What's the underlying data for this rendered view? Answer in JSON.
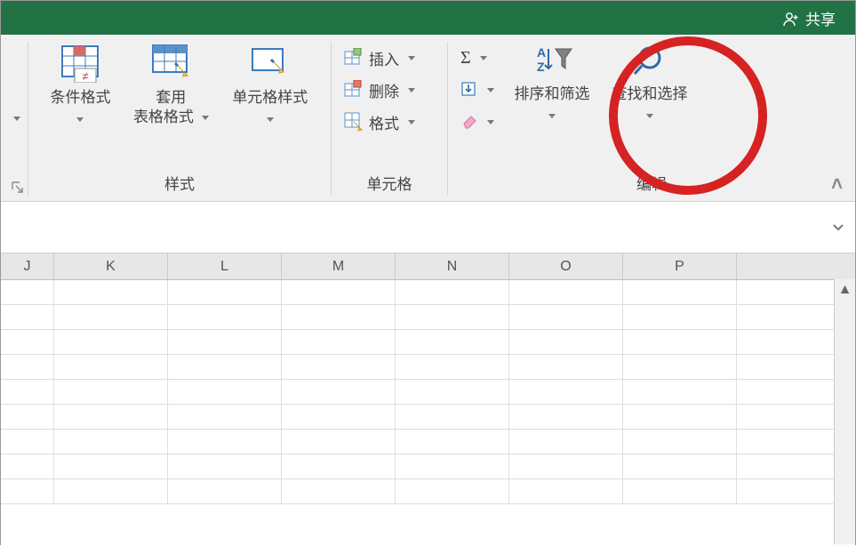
{
  "titlebar": {
    "share": "共享"
  },
  "styles_group": {
    "label": "样式",
    "cond_format": "条件格式",
    "table_format": "套用\n表格格式",
    "cell_styles": "单元格样式"
  },
  "cells_group": {
    "label": "单元格",
    "insert": "插入",
    "delete": "删除",
    "format": "格式"
  },
  "edit_group": {
    "label": "编辑",
    "sort_filter": "排序和筛选",
    "find_select": "查找和选择"
  },
  "columns": [
    "J",
    "K",
    "L",
    "M",
    "N",
    "O",
    "P"
  ],
  "icons": {
    "autosum": "Σ",
    "collapse": "˄"
  }
}
